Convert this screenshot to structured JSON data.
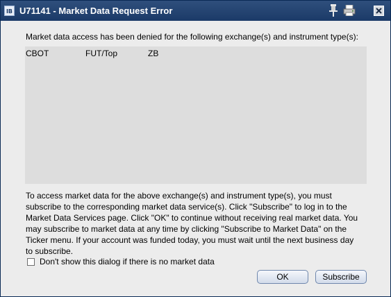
{
  "window": {
    "title": "U71141 - Market Data Request Error",
    "app_icon_text": "IB",
    "icons": [
      "pin-icon",
      "print-icon",
      "close-icon"
    ]
  },
  "message": {
    "header": "Market data access has been denied for the following exchange(s) and instrument type(s):",
    "rows": [
      {
        "exchange": "CBOT",
        "instrument_type": "FUT/Top",
        "symbol": "ZB"
      }
    ],
    "info_lines": [
      "To access market data for the above exchange(s) and instrument type(s), you must",
      "subscribe to the corresponding market data service(s). Click \"Subscribe\" to log in to the",
      "Market Data Services page. Click \"OK\" to continue without receiving real market data. You",
      "may subscribe to market data at any time by clicking \"Subscribe to Market Data\" on the",
      "Ticker menu. If your account was funded today, you must wait until the next business day",
      "to subscribe."
    ]
  },
  "checkbox": {
    "label": "Don't show this dialog if there is no market data",
    "checked": false
  },
  "buttons": {
    "ok": "OK",
    "subscribe": "Subscribe"
  },
  "colors": {
    "titlebar": "#1f3f6e",
    "background": "#ececec",
    "list_background": "#dddddd"
  }
}
